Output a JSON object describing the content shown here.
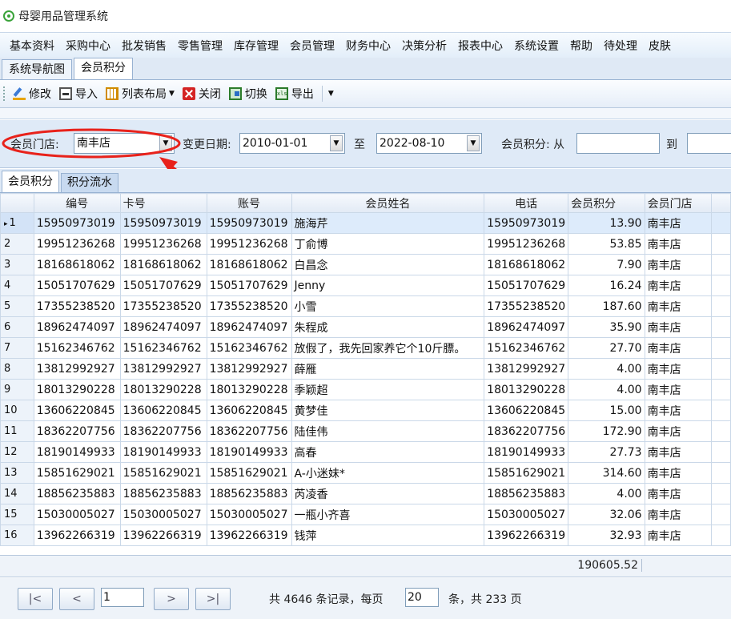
{
  "app": {
    "title": "母婴用品管理系统",
    "logo_icon": "app-logo-icon"
  },
  "menu": [
    "基本资料",
    "采购中心",
    "批发销售",
    "零售管理",
    "库存管理",
    "会员管理",
    "财务中心",
    "决策分析",
    "报表中心",
    "系统设置",
    "帮助",
    "待处理",
    "皮肤"
  ],
  "doc_tabs": [
    {
      "label": "系统导航图",
      "active": false
    },
    {
      "label": "会员积分",
      "active": true
    }
  ],
  "toolbar": {
    "edit_label": "修改",
    "import_label": "导入",
    "layout_label": "列表布局",
    "close_label": "关闭",
    "switch_label": "切换",
    "export_label": "导出",
    "icons": [
      "edit-icon",
      "import-icon",
      "layout-icon",
      "close-icon",
      "switch-icon",
      "export-icon"
    ]
  },
  "filter": {
    "store_label": "会员门店:",
    "store_value": "南丰店",
    "date_label": "变更日期:",
    "date_from": "2010-01-01",
    "date_to_label": "至",
    "date_to": "2022-08-10",
    "points_label": "会员积分: 从",
    "points_from": "",
    "points_to_label": "到",
    "points_to": "",
    "dropdown_glyph": "▼"
  },
  "annotation": {
    "color": "#e8221b"
  },
  "grid_tabs": [
    {
      "label": "会员积分",
      "active": true
    },
    {
      "label": "积分流水",
      "active": false
    }
  ],
  "grid": {
    "current_marker": "▸",
    "columns": [
      "编号",
      "卡号",
      "账号",
      "会员姓名",
      "电话",
      "会员积分",
      "会员门店"
    ],
    "rows": [
      [
        "1",
        "15950973019",
        "15950973019",
        "15950973019",
        "施海芹",
        "15950973019",
        "13.90",
        "南丰店"
      ],
      [
        "2",
        "19951236268",
        "19951236268",
        "19951236268",
        "丁俞博",
        "19951236268",
        "53.85",
        "南丰店"
      ],
      [
        "3",
        "18168618062",
        "18168618062",
        "18168618062",
        "白昌念",
        "18168618062",
        "7.90",
        "南丰店"
      ],
      [
        "4",
        "15051707629",
        "15051707629",
        "15051707629",
        "Jenny",
        "15051707629",
        "16.24",
        "南丰店"
      ],
      [
        "5",
        "17355238520",
        "17355238520",
        "17355238520",
        "小雪",
        "17355238520",
        "187.60",
        "南丰店"
      ],
      [
        "6",
        "18962474097",
        "18962474097",
        "18962474097",
        "朱程成",
        "18962474097",
        "35.90",
        "南丰店"
      ],
      [
        "7",
        "15162346762",
        "15162346762",
        "15162346762",
        "放假了，我先回家养它个10斤膘。",
        "15162346762",
        "27.70",
        "南丰店"
      ],
      [
        "8",
        "13812992927",
        "13812992927",
        "13812992927",
        "薛雁",
        "13812992927",
        "4.00",
        "南丰店"
      ],
      [
        "9",
        "18013290228",
        "18013290228",
        "18013290228",
        "季颖超",
        "18013290228",
        "4.00",
        "南丰店"
      ],
      [
        "10",
        "13606220845",
        "13606220845",
        "13606220845",
        "黄梦佳",
        "13606220845",
        "15.00",
        "南丰店"
      ],
      [
        "11",
        "18362207756",
        "18362207756",
        "18362207756",
        "陆佳伟",
        "18362207756",
        "172.90",
        "南丰店"
      ],
      [
        "12",
        "18190149933",
        "18190149933",
        "18190149933",
        "高春",
        "18190149933",
        "27.73",
        "南丰店"
      ],
      [
        "13",
        "15851629021",
        "15851629021",
        "15851629021",
        "A-小迷妹*",
        "15851629021",
        "314.60",
        "南丰店"
      ],
      [
        "14",
        "18856235883",
        "18856235883",
        "18856235883",
        "芮凌香",
        "18856235883",
        "4.00",
        "南丰店"
      ],
      [
        "15",
        "15030005027",
        "15030005027",
        "15030005027",
        "一瓶小齐喜",
        "15030005027",
        "32.06",
        "南丰店"
      ],
      [
        "16",
        "13962266319",
        "13962266319",
        "13962266319",
        "钱萍",
        "13962266319",
        "32.93",
        "南丰店"
      ]
    ],
    "total_points": "190605.52"
  },
  "pager": {
    "first": "|<",
    "prev": "<",
    "next": ">",
    "last": ">|",
    "page_value": "1",
    "total_text": "共 4646 条记录，每页",
    "page_size": "20",
    "pages_text": "条，共 233 页"
  }
}
